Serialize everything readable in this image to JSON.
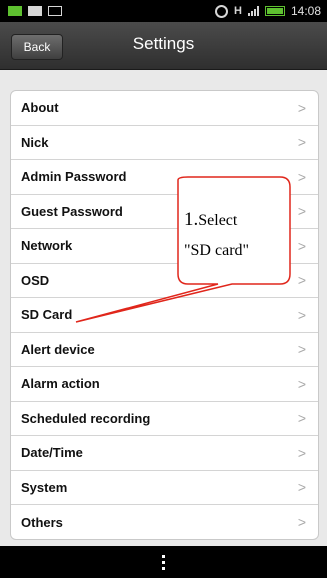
{
  "status_bar": {
    "clock": "14:08",
    "network_type": "H",
    "icons": [
      "app-notification-icon",
      "message-icon",
      "mail-icon",
      "alarm-icon",
      "hspa-icon",
      "signal-icon",
      "battery-icon"
    ]
  },
  "header": {
    "back_label": "Back",
    "title": "Settings"
  },
  "settings": {
    "items": [
      {
        "label": "About"
      },
      {
        "label": "Nick"
      },
      {
        "label": "Admin Password"
      },
      {
        "label": "Guest Password"
      },
      {
        "label": "Network"
      },
      {
        "label": "OSD"
      },
      {
        "label": "SD Card"
      },
      {
        "label": "Alert device"
      },
      {
        "label": "Alarm action"
      },
      {
        "label": "Scheduled recording"
      },
      {
        "label": "Date/Time"
      },
      {
        "label": "System"
      },
      {
        "label": "Others"
      }
    ],
    "chevron": ">"
  },
  "annotation": {
    "line1": "1.",
    "line1b": "Select",
    "line2": "\"SD card\"",
    "color": "#e0261b"
  },
  "nav_bar": {
    "icon": "menu-icon"
  }
}
